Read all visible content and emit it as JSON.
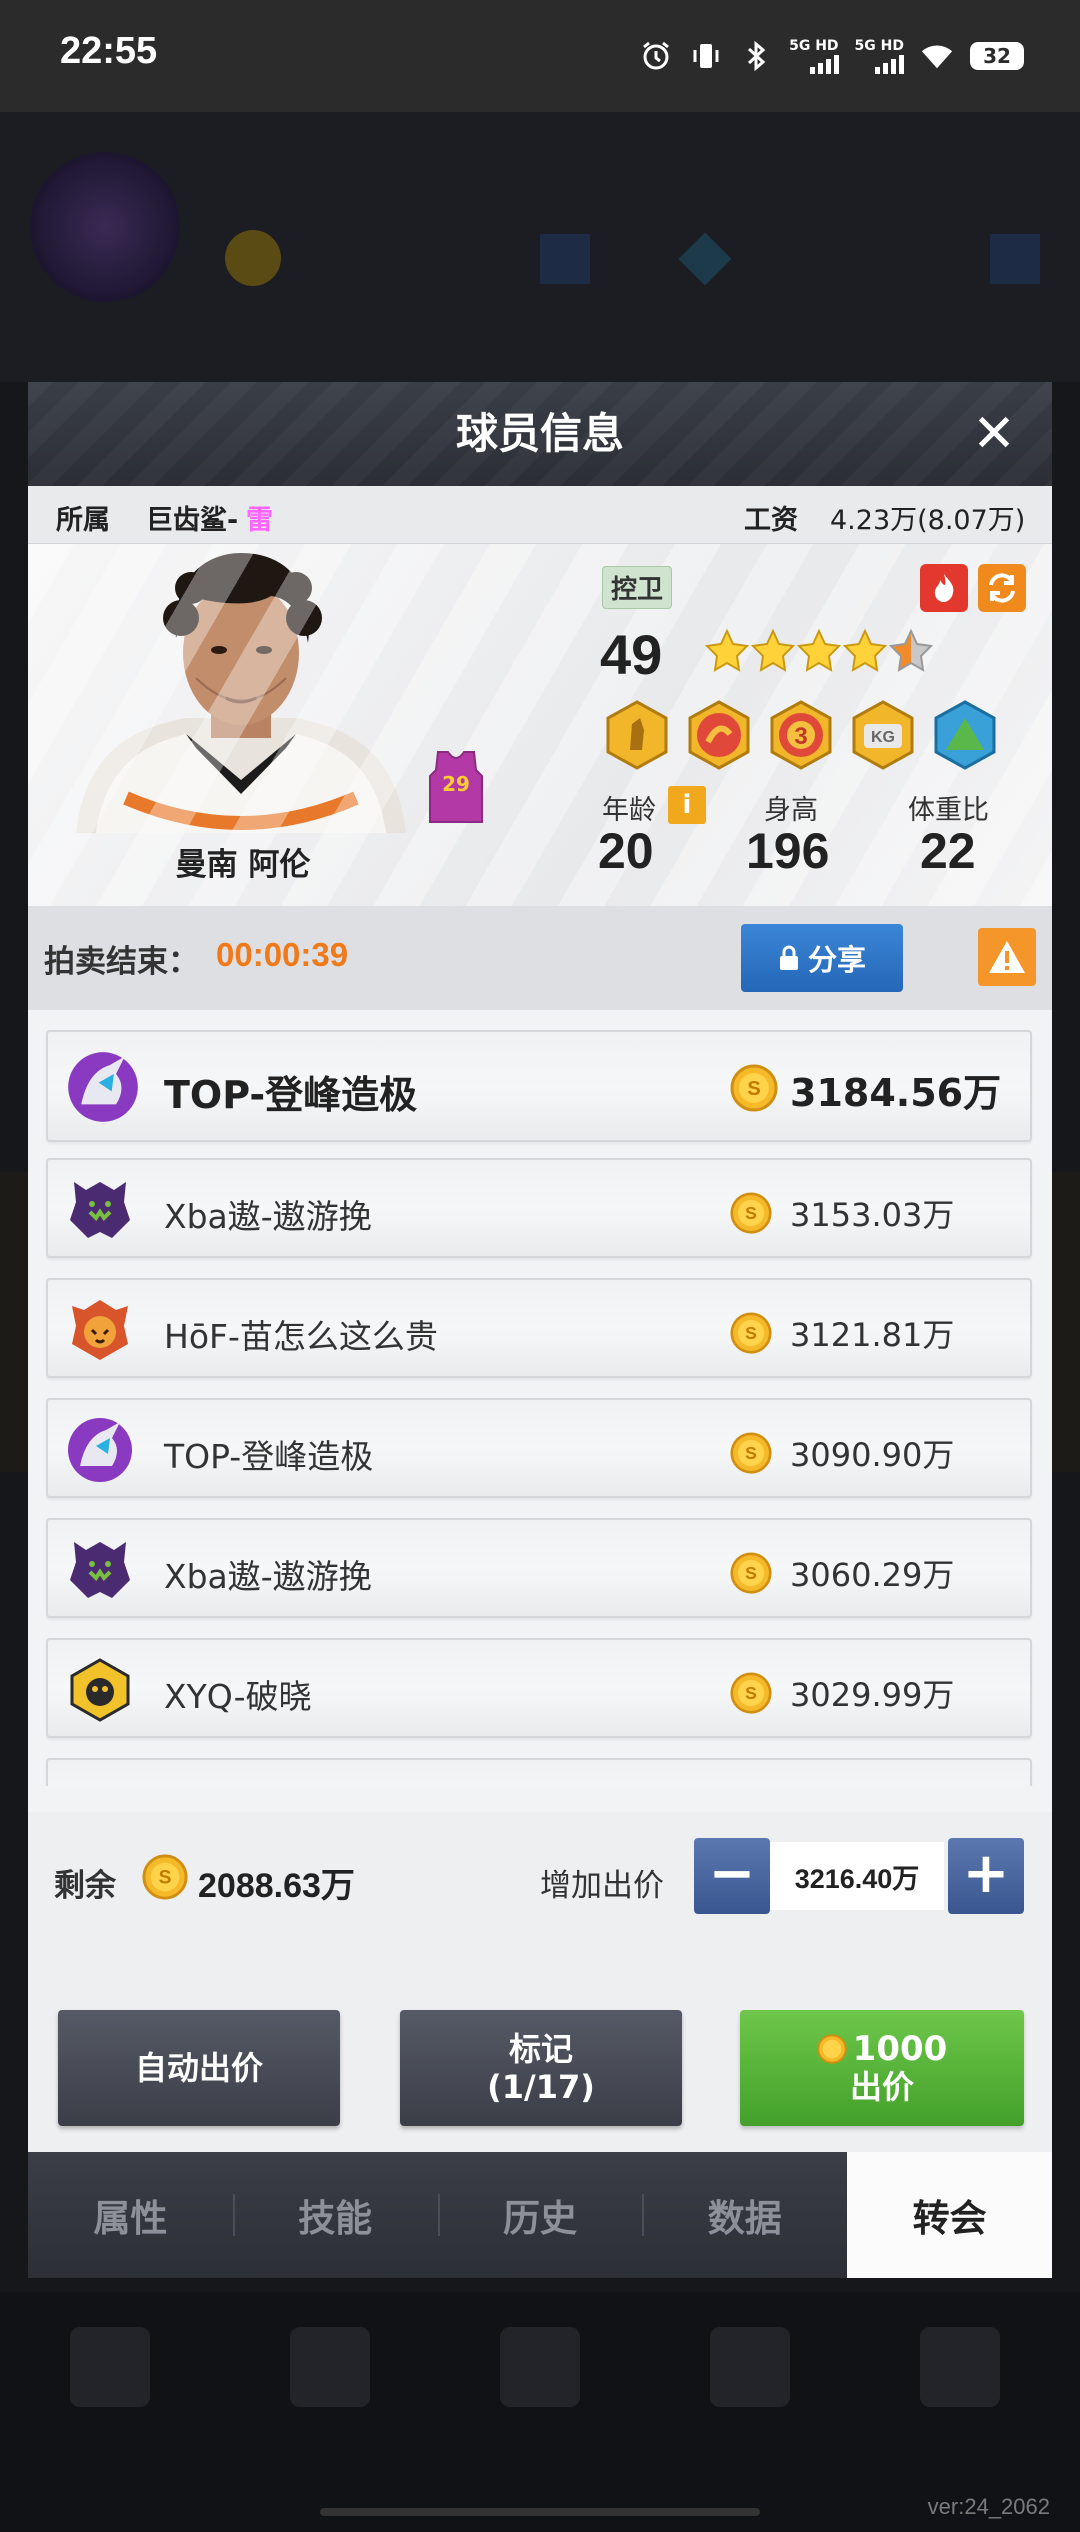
{
  "status_bar": {
    "time": "22:55",
    "network_1": "5G HD",
    "network_2": "5G HD",
    "battery": "32"
  },
  "modal": {
    "title": "球员信息",
    "close_icon": "close-icon"
  },
  "info": {
    "team_label": "所属",
    "team_name": "巨齿鲨-",
    "team_suffix": "雷",
    "salary_label": "工资",
    "salary_value": "4.23万(8.07万)"
  },
  "player": {
    "name": "曼南 阿伦",
    "jersey_number": "29",
    "position": "控卫",
    "overall": "49",
    "stars": 4.5,
    "age_label": "年龄",
    "age": "20",
    "height_label": "身高",
    "height": "196",
    "weight_ratio_label": "体重比",
    "weight_ratio": "22"
  },
  "auction": {
    "ends_label": "拍卖结束：",
    "countdown": "00:00:39",
    "share_label": "分享"
  },
  "bids": [
    {
      "team": "TOP-登峰造极",
      "amount": "3184.56万",
      "logo": "unicorn"
    },
    {
      "team": "Xba遨-遨游挽",
      "amount": "3153.03万",
      "logo": "wolf"
    },
    {
      "team": "HōF-苗怎么这么贵",
      "amount": "3121.81万",
      "logo": "tiger"
    },
    {
      "team": "TOP-登峰造极",
      "amount": "3090.90万",
      "logo": "unicorn"
    },
    {
      "team": "Xba遨-遨游挽",
      "amount": "3060.29万",
      "logo": "wolf"
    },
    {
      "team": "XYQ-破晓",
      "amount": "3029.99万",
      "logo": "lion"
    }
  ],
  "wallet": {
    "remaining_label": "剩余",
    "remaining_value": "2088.63万",
    "raise_label": "增加出价",
    "bid_value": "3216.40万"
  },
  "actions": {
    "auto_bid": "自动出价",
    "mark_line1": "标记",
    "mark_line2": "(1/17)",
    "bid_cost": "1000",
    "bid_label": "出价"
  },
  "tabs": [
    "属性",
    "技能",
    "历史",
    "数据",
    "转会"
  ],
  "active_tab": "转会",
  "background": {
    "version": "ver:24_2062"
  },
  "colors": {
    "countdown": "#f07a1a",
    "share_button": "#2f75c6",
    "bid_button": "#56b43a",
    "team_suffix": "#ff66ff"
  }
}
